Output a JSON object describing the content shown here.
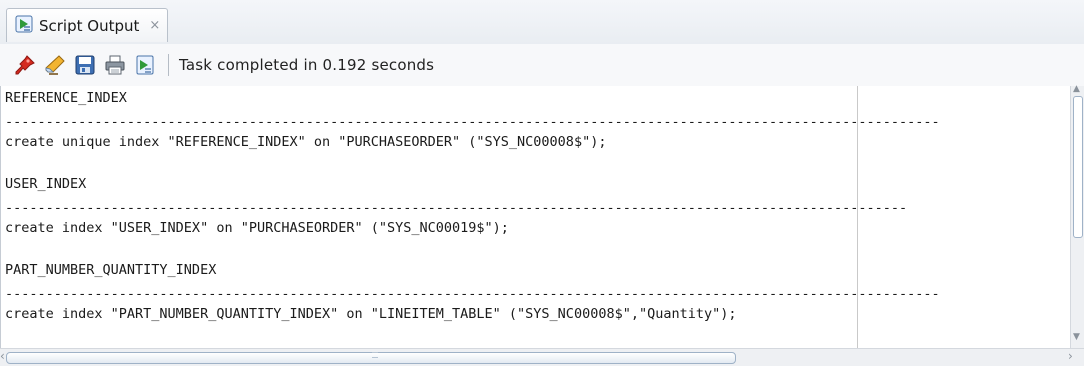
{
  "tab": {
    "label": "Script Output",
    "close_glyph": "×",
    "icon": "script-output-icon"
  },
  "toolbar": {
    "icons": [
      "pin-icon",
      "eraser-icon",
      "save-icon",
      "print-icon",
      "open-file-icon"
    ],
    "status": "Task completed in 0.192 seconds"
  },
  "output": {
    "lines": [
      "REFERENCE_INDEX",
      "-------------------------------------------------------------------------------------------------------------------",
      "create unique index \"REFERENCE_INDEX\" on \"PURCHASEORDER\" (\"SYS_NC00008$\");",
      "USER_INDEX",
      "---------------------------------------------------------------------------------------------------------------",
      "create index \"USER_INDEX\" on \"PURCHASEORDER\" (\"SYS_NC00019$\");",
      "PART_NUMBER_QUANTITY_INDEX",
      "-------------------------------------------------------------------------------------------------------------------",
      "create index \"PART_NUMBER_QUANTITY_INDEX\" on \"LINEITEM_TABLE\" (\"SYS_NC00008$\",\"Quantity\");"
    ]
  },
  "scroll": {
    "horizontal_position_fraction": 0.0,
    "vertical_position_fraction": 0.0
  }
}
